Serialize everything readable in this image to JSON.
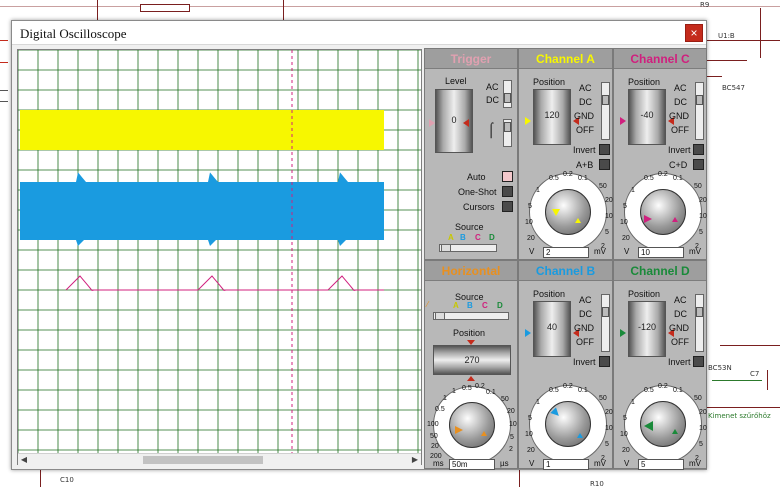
{
  "window": {
    "title": "Digital Oscilloscope",
    "close_label": "×"
  },
  "background": {
    "labels": {
      "r9": "R9",
      "u1b": "U1:B",
      "r10": "R10",
      "c10": "C10",
      "c7": "C7",
      "part": "BC547",
      "sig": "BC53N",
      "misc": "Kimenet szűrőhöz"
    }
  },
  "trigger": {
    "title": "Trigger",
    "level_label": "Level",
    "level_value": "0",
    "ac": "AC",
    "dc": "DC",
    "auto": "Auto",
    "one_shot": "One-Shot",
    "cursors": "Cursors",
    "source_label": "Source",
    "source_letters": [
      "A",
      "B",
      "C",
      "D"
    ]
  },
  "channel_a": {
    "title": "Channel A",
    "position_label": "Position",
    "position_value": "120",
    "ac": "AC",
    "dc": "DC",
    "gnd": "GND",
    "off": "OFF",
    "invert": "Invert",
    "sum": "A+B",
    "field_value": "2",
    "unit_left": "V",
    "unit_right": "mV",
    "scale": [
      "0.5",
      "0.2",
      "0.1",
      "50",
      "20",
      "10",
      "5",
      "2",
      "1",
      "5",
      "10",
      "20"
    ]
  },
  "channel_c": {
    "title": "Channel C",
    "position_label": "Position",
    "position_value": "-40",
    "ac": "AC",
    "dc": "DC",
    "gnd": "GND",
    "off": "OFF",
    "invert": "Invert",
    "sum": "C+D",
    "field_value": "10",
    "unit_left": "V",
    "unit_right": "mV",
    "scale": [
      "0.5",
      "0.2",
      "0.1",
      "50",
      "20",
      "10",
      "5",
      "2",
      "1",
      "5",
      "10",
      "20"
    ]
  },
  "horizontal": {
    "title": "Horizontal",
    "source_label": "Source",
    "source_letters": [
      "A",
      "B",
      "C",
      "D"
    ],
    "position_label": "Position",
    "position_value": "270",
    "field_value": "50m",
    "unit_left": "ms",
    "unit_right": "µs",
    "scale": [
      "1",
      "0.5",
      "0.2",
      "0.1",
      "50",
      "20",
      "10",
      "5",
      "2",
      "1",
      "0.5",
      "200",
      "100",
      "50",
      "20",
      "10",
      "5",
      "2"
    ]
  },
  "channel_b": {
    "title": "Channel B",
    "position_label": "Position",
    "position_value": "40",
    "ac": "AC",
    "dc": "DC",
    "gnd": "GND",
    "off": "OFF",
    "invert": "Invert",
    "field_value": "1",
    "unit_left": "V",
    "unit_right": "mV",
    "scale": [
      "0.5",
      "0.2",
      "0.1",
      "50",
      "20",
      "10",
      "5",
      "2",
      "1",
      "5",
      "10",
      "20"
    ]
  },
  "channel_d": {
    "title": "Channel D",
    "position_label": "Position",
    "position_value": "-120",
    "ac": "AC",
    "dc": "DC",
    "gnd": "GND",
    "off": "OFF",
    "invert": "Invert",
    "field_value": "5",
    "unit_left": "V",
    "unit_right": "mV",
    "scale": [
      "0.5",
      "0.2",
      "0.1",
      "50",
      "20",
      "10",
      "5",
      "2",
      "1",
      "5",
      "10",
      "20"
    ]
  },
  "colors": {
    "channel_a": "#f7f700",
    "channel_b": "#1a9be0",
    "channel_c": "#d0207e",
    "channel_d": "#1a8a3a",
    "trigger": "#e0a0b0",
    "horizontal": "#e89020",
    "grid": "#1d6e1d"
  }
}
